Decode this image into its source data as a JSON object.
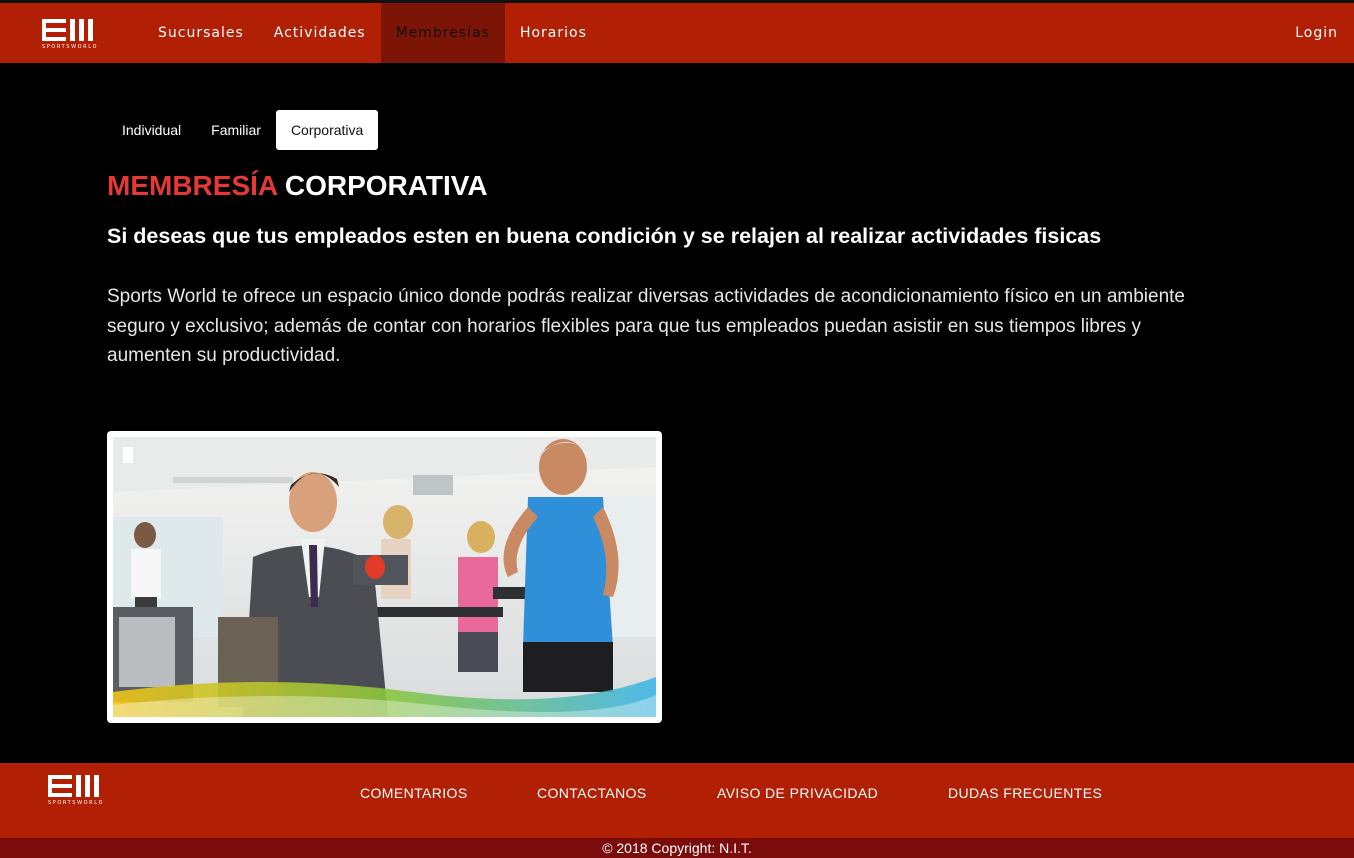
{
  "brand": {
    "logo_text": "SPORTSWORLD"
  },
  "nav": {
    "items": [
      {
        "label": "Sucursales"
      },
      {
        "label": "Actividades"
      },
      {
        "label": "Membresías"
      },
      {
        "label": "Horarios"
      }
    ],
    "active": "Membresías",
    "login": "Login"
  },
  "tabs": {
    "items": [
      {
        "label": "Individual"
      },
      {
        "label": "Familiar"
      },
      {
        "label": "Corporativa"
      }
    ],
    "active": "Corporativa"
  },
  "content": {
    "title_accent": "MEMBRESÍA",
    "title_rest": "CORPORATIVA",
    "subtitle": "Si deseas que tus empleados esten en buena condición y se relajen al realizar actividades fisicas",
    "description": "Sports World te ofrece un espacio único donde podrás realizar diversas actividades de acondicionamiento físico en un ambiente seguro y exclusivo; además de contar con horarios flexibles para que tus empleados puedan asistir en sus tiempos libres y aumenten su productividad."
  },
  "footer": {
    "links": [
      {
        "label": "COMENTARIOS"
      },
      {
        "label": "CONTACTANOS"
      },
      {
        "label": "AVISO DE PRIVACIDAD"
      },
      {
        "label": "DUDAS FRECUENTES"
      }
    ],
    "copyright": "© 2018 Copyright: N.I.T."
  },
  "colors": {
    "brand_red": "#b11f04",
    "nav_active": "#7c1505",
    "title_accent": "#e53935",
    "copyright_bar": "#7a0c0c",
    "background": "#000000"
  }
}
